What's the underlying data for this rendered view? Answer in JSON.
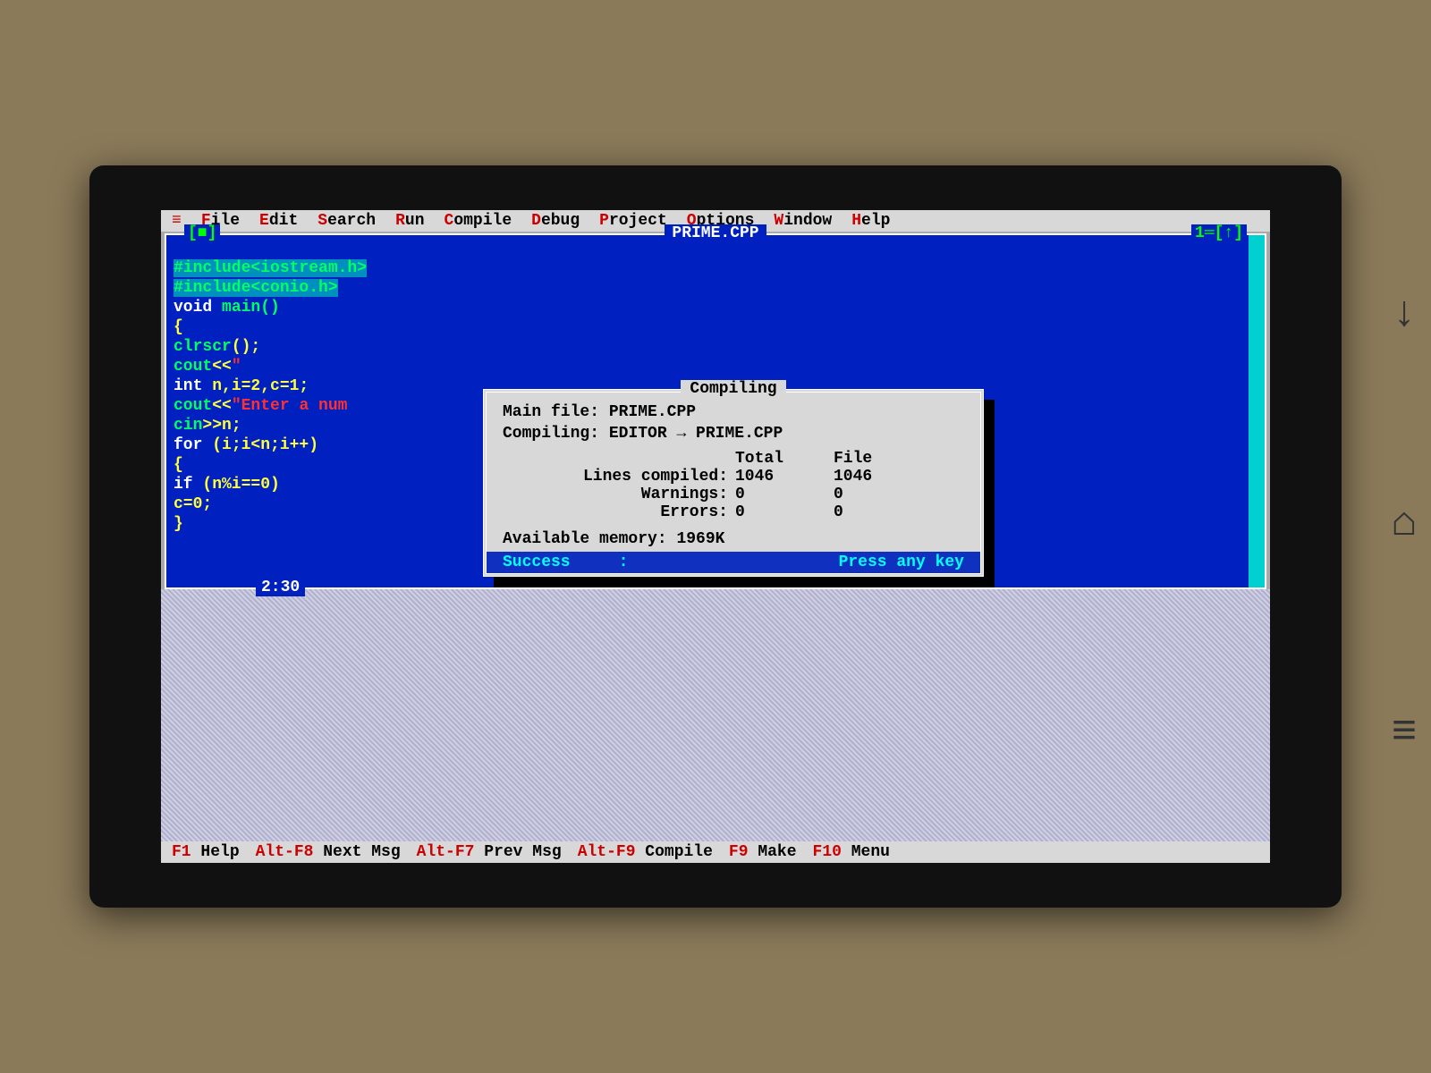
{
  "menu": {
    "items": [
      {
        "hot": "≡",
        "rest": ""
      },
      {
        "hot": "F",
        "rest": "ile"
      },
      {
        "hot": "E",
        "rest": "dit"
      },
      {
        "hot": "S",
        "rest": "earch"
      },
      {
        "hot": "R",
        "rest": "un"
      },
      {
        "hot": "C",
        "rest": "ompile"
      },
      {
        "hot": "D",
        "rest": "ebug"
      },
      {
        "hot": "P",
        "rest": "roject"
      },
      {
        "hot": "O",
        "rest": "ptions"
      },
      {
        "hot": "W",
        "rest": "indow"
      },
      {
        "hot": "H",
        "rest": "elp"
      }
    ]
  },
  "editor": {
    "title": "PRIME.CPP",
    "top_left": "[■]",
    "top_right": "1═[↑]",
    "cursor_pos": "2:30",
    "code": {
      "l1a": "#include<iostream.h>",
      "l2a": "#include<conio.h>",
      "l3a": "void ",
      "l3b": "main()",
      "l4a": "{",
      "l5a": "clrscr",
      "l5b": "();",
      "l6a": "cout",
      "l6b": "<<",
      "l6c": "\"",
      "l7a": "int ",
      "l7b": "n,i=2,c=1;",
      "l8a": "cout",
      "l8b": "<<",
      "l8c": "\"Enter a num",
      "l9a": "cin",
      "l9b": ">>",
      "l9c": "n;",
      "l10a": "for ",
      "l10b": "(i;i<n;i++)",
      "l11a": "{",
      "l12a": "if ",
      "l12b": "(n%i==0)",
      "l13a": "c=0;",
      "l14a": "}"
    }
  },
  "dialog": {
    "title": "Compiling",
    "main_file_lbl": "Main file:",
    "main_file": "PRIME.CPP",
    "compiling_lbl": "Compiling:",
    "compiling": "EDITOR → PRIME.CPP",
    "col_total": "Total",
    "col_file": "File",
    "rows": [
      {
        "label": "Lines compiled:",
        "total": "1046",
        "file": "1046"
      },
      {
        "label": "Warnings:",
        "total": "0",
        "file": "0"
      },
      {
        "label": "Errors:",
        "total": "0",
        "file": "0"
      }
    ],
    "mem_lbl": "Available memory:",
    "mem": "1969K",
    "status": "Success",
    "status_sep": ":",
    "prompt": "Press any key"
  },
  "status": {
    "items": [
      {
        "hot": "F1",
        "rest": " Help"
      },
      {
        "hot": "Alt-F8",
        "rest": " Next Msg"
      },
      {
        "hot": "Alt-F7",
        "rest": " Prev Msg"
      },
      {
        "hot": "Alt-F9",
        "rest": " Compile"
      },
      {
        "hot": "F9",
        "rest": " Make"
      },
      {
        "hot": "F10",
        "rest": " Menu"
      }
    ]
  },
  "device_buttons": {
    "down": "↓",
    "home": "⌂",
    "menu": "≡"
  }
}
